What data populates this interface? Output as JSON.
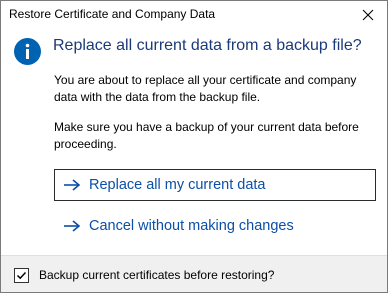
{
  "window": {
    "title": "Restore Certificate and Company Data"
  },
  "main": {
    "heading": "Replace all current data from a backup file?",
    "paragraph1": "You are about to replace all your certificate and company data with the data from the backup file.",
    "paragraph2": "Make sure you have a backup of your current data before proceeding."
  },
  "commands": [
    {
      "label": "Replace all my current data",
      "icon": "arrow-right-icon"
    },
    {
      "label": "Cancel without making changes",
      "icon": "arrow-right-icon"
    }
  ],
  "footer": {
    "checkbox_label": "Backup current certificates before restoring?",
    "checkbox_checked": true
  },
  "colors": {
    "accent": "#0063b1",
    "heading": "#1b3a7a",
    "command": "#0b4fa8",
    "footer_bg": "#f0f0f0"
  }
}
